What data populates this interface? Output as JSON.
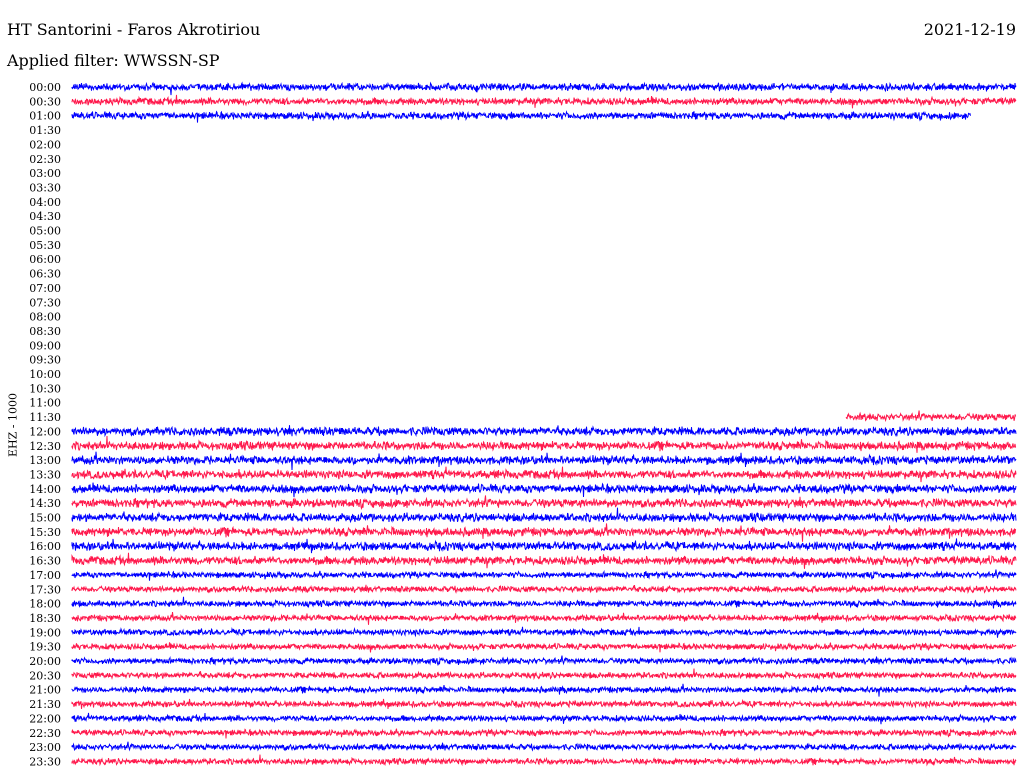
{
  "header": {
    "station": "HT Santorini - Faros Akrotiriou",
    "date": "2021-12-19",
    "filter": "Applied filter: WWSSN-SP",
    "channel": "EHZ - 1000"
  },
  "chart_data": {
    "type": "line",
    "title": "HT Santorini - Faros Akrotiriou",
    "ylabel": "EHZ - 1000",
    "row_labels": [
      "00:00",
      "00:30",
      "01:00",
      "01:30",
      "02:00",
      "02:30",
      "03:00",
      "03:30",
      "04:00",
      "04:30",
      "05:00",
      "05:30",
      "06:00",
      "06:30",
      "07:00",
      "07:30",
      "08:00",
      "08:30",
      "09:00",
      "09:30",
      "10:00",
      "10:30",
      "11:00",
      "11:30",
      "12:00",
      "12:30",
      "13:00",
      "13:30",
      "14:00",
      "14:30",
      "15:00",
      "15:30",
      "16:00",
      "16:30",
      "17:00",
      "17:30",
      "18:00",
      "18:30",
      "19:00",
      "19:30",
      "20:00",
      "20:30",
      "21:00",
      "21:30",
      "22:00",
      "22:30",
      "23:00",
      "23:30"
    ],
    "colors": [
      "#0000ff",
      "#ff1a4d"
    ],
    "rows_with_data": [
      {
        "label": "00:00",
        "start_fraction": 0.0,
        "end_fraction": 1.0
      },
      {
        "label": "00:30",
        "start_fraction": 0.0,
        "end_fraction": 1.0
      },
      {
        "label": "01:00",
        "start_fraction": 0.0,
        "end_fraction": 0.952
      },
      {
        "label": "11:30",
        "start_fraction": 0.82,
        "end_fraction": 1.0
      },
      {
        "label": "12:00",
        "start_fraction": 0.0,
        "end_fraction": 1.0
      },
      {
        "label": "12:30",
        "start_fraction": 0.0,
        "end_fraction": 1.0
      },
      {
        "label": "13:00",
        "start_fraction": 0.0,
        "end_fraction": 1.0
      },
      {
        "label": "13:30",
        "start_fraction": 0.0,
        "end_fraction": 1.0
      },
      {
        "label": "14:00",
        "start_fraction": 0.0,
        "end_fraction": 1.0
      },
      {
        "label": "14:30",
        "start_fraction": 0.0,
        "end_fraction": 1.0
      },
      {
        "label": "15:00",
        "start_fraction": 0.0,
        "end_fraction": 1.0
      },
      {
        "label": "15:30",
        "start_fraction": 0.0,
        "end_fraction": 1.0
      },
      {
        "label": "16:00",
        "start_fraction": 0.0,
        "end_fraction": 1.0
      },
      {
        "label": "16:30",
        "start_fraction": 0.0,
        "end_fraction": 1.0
      },
      {
        "label": "17:00",
        "start_fraction": 0.0,
        "end_fraction": 1.0
      },
      {
        "label": "17:30",
        "start_fraction": 0.0,
        "end_fraction": 1.0
      },
      {
        "label": "18:00",
        "start_fraction": 0.0,
        "end_fraction": 1.0
      },
      {
        "label": "18:30",
        "start_fraction": 0.0,
        "end_fraction": 1.0
      },
      {
        "label": "19:00",
        "start_fraction": 0.0,
        "end_fraction": 1.0
      },
      {
        "label": "19:30",
        "start_fraction": 0.0,
        "end_fraction": 1.0
      },
      {
        "label": "20:00",
        "start_fraction": 0.0,
        "end_fraction": 1.0
      },
      {
        "label": "20:30",
        "start_fraction": 0.0,
        "end_fraction": 1.0
      },
      {
        "label": "21:00",
        "start_fraction": 0.0,
        "end_fraction": 1.0
      },
      {
        "label": "21:30",
        "start_fraction": 0.0,
        "end_fraction": 1.0
      },
      {
        "label": "22:00",
        "start_fraction": 0.0,
        "end_fraction": 1.0
      },
      {
        "label": "22:30",
        "start_fraction": 0.0,
        "end_fraction": 1.0
      },
      {
        "label": "23:00",
        "start_fraction": 0.0,
        "end_fraction": 1.0
      },
      {
        "label": "23:30",
        "start_fraction": 0.0,
        "end_fraction": 1.0
      }
    ]
  }
}
